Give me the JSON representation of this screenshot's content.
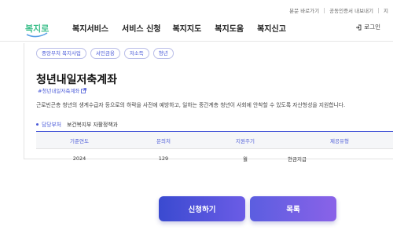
{
  "util_links": [
    "분문 바로가기",
    "공동인증서 내보내기",
    "지"
  ],
  "logo_text": "복지로",
  "nav": [
    "복지서비스",
    "서비스 신청",
    "복지지도",
    "복지도움",
    "복지신고"
  ],
  "login_label": "로그인",
  "tags": [
    "중앙부처 복지사업",
    "서민금융",
    "저소득",
    "청년"
  ],
  "title": "청년내일저축계좌",
  "hashtag": "#청년내일저축계좌",
  "description": "근로빈곤층 청년의 생계수급자 등으로의 하락을 사전에 예방하고, 일하는 중간계층 청년이 사회에 안착할 수 있도록 자산형성을 지원합니다.",
  "dept": {
    "label": "담당부처",
    "value": "보건복지부 자활정책과"
  },
  "table": {
    "headers": [
      "기준연도",
      "문의처",
      "지원주기",
      "제공유형"
    ],
    "row": [
      "2024",
      "129",
      "월",
      "현금지급"
    ]
  },
  "buttons": {
    "apply": "신청하기",
    "list": "목록"
  },
  "colors": {
    "accent": "#4a5ad8",
    "logo_green": "#3bbf8a"
  }
}
